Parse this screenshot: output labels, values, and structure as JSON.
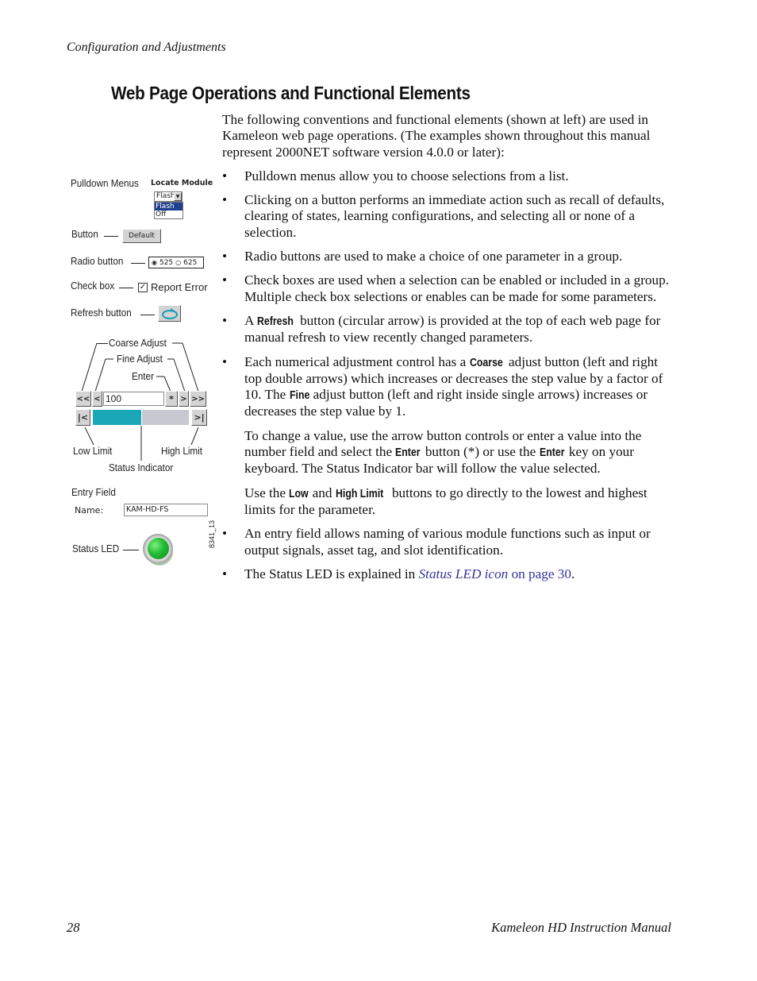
{
  "running_head": "Configuration and Adjustments",
  "section_title": "Web Page Operations and Functional Elements",
  "intro": "The following conventions and functional elements (shown at left) are used in Kameleon web page operations. (The examples shown throughout this manual represent 2000NET software version 4.0.0 or later):",
  "bullets": [
    {
      "text": "Pulldown menus allow you to choose selections from a list."
    },
    {
      "text": "Clicking on a button performs an immediate action such as recall of defaults, clearing of states, learning configurations, and selecting all or none of a selection."
    },
    {
      "text": "Radio buttons are used to make a choice of one parameter in a group."
    },
    {
      "text": "Check boxes are used when a selection can be enabled or included in a group. Multiple check box selections or enables can be made for some parameters."
    },
    {
      "pre": "A ",
      "kw": "Refresh",
      "post": " button (circular arrow) is provided at the top of each web page for manual refresh to view recently changed parameters."
    },
    {
      "p1_pre": "Each numerical adjustment control has a ",
      "p1_kw1": "Coarse",
      "p1_mid": " adjust button (left and right top double arrows) which increases or decreases the step value by a factor of 10. The ",
      "p1_kw2": "Fine",
      "p1_post": " adjust button (left and right inside single arrows) increases or decreases the step value by 1.",
      "p2_pre": "To change a value, use the arrow button controls or enter a value into the number field and select the ",
      "p2_kw1": "Enter",
      "p2_mid": " button (*) or use the ",
      "p2_kw2": "Enter",
      "p2_post": " key on your keyboard. The Status Indicator bar will follow the value selected.",
      "p3_pre": "Use the ",
      "p3_kw1": "Low",
      "p3_mid": " and ",
      "p3_kw2": "High Limit",
      "p3_post": " buttons to go directly to the lowest and highest limits for the parameter."
    },
    {
      "text": "An entry field allows naming of various module functions such as input or output signals, asset tag, and slot identification."
    },
    {
      "pre": "The Status LED is explained in ",
      "link_italic": "Status LED icon",
      "link_rest": " on page 30",
      "post": "."
    }
  ],
  "bullet_char": "•",
  "figure": {
    "labels": {
      "pulldown": "Pulldown Menus",
      "button": "Button",
      "radio": "Radio button",
      "checkbox": "Check box",
      "refresh": "Refresh button",
      "coarse": "Coarse Adjust",
      "fine": "Fine Adjust",
      "enter": "Enter",
      "low_limit": "Low Limit",
      "high_limit": "High Limit",
      "status_indicator": "Status Indicator",
      "entry_field": "Entry Field",
      "status_led": "Status LED",
      "figure_id": "8341_13"
    },
    "pulldown": {
      "title": "Locate Module",
      "selected": "Flash",
      "options": [
        "Flash",
        "Off"
      ],
      "highlight": "#1f3f8f"
    },
    "default_button": "Default",
    "radio": {
      "options": [
        "525",
        "625"
      ],
      "selected": "525"
    },
    "checkbox": {
      "label": "Report Error",
      "checked": true
    },
    "numeric": {
      "coarse_down": "<<",
      "fine_down": "<",
      "value": "100",
      "enter": "*",
      "fine_up": ">",
      "coarse_up": ">>",
      "low_limit": "|<",
      "high_limit": ">|",
      "indicator_fraction": 0.5,
      "fill_color": "#1aa8b8",
      "rest_color": "#c8c8d0"
    },
    "entry": {
      "label": "Name:",
      "value": "KAM-HD-FS"
    },
    "led_color": "#22bb33"
  },
  "footer": {
    "page_number": "28",
    "manual_title": "Kameleon HD Instruction Manual"
  }
}
